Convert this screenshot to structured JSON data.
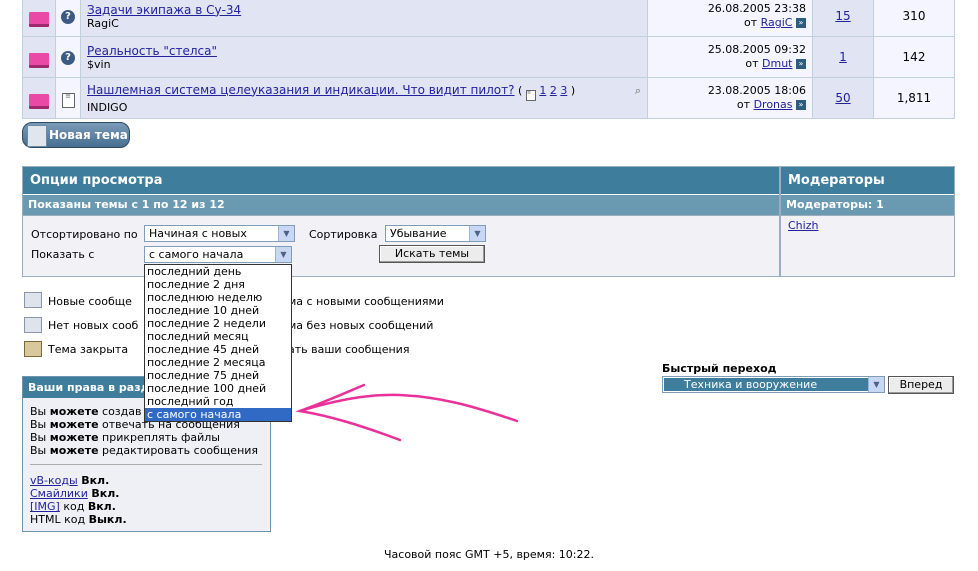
{
  "threads": [
    {
      "title": "Задачи экипажа в Су-34",
      "author": "RagiC",
      "last_date": "26.08.2005 23:38",
      "last_by": "от",
      "last_user": "RagiC",
      "replies": "15",
      "views": "310",
      "pages": null
    },
    {
      "title": "Реальность \"стелса\"",
      "author": "$vin",
      "last_date": "25.08.2005 09:32",
      "last_by": "от",
      "last_user": "Dmut",
      "replies": "1",
      "views": "142",
      "pages": null
    },
    {
      "title": "Нашлемная система целеуказания и индикации. Что видит пилот?",
      "author": "INDIGO",
      "last_date": "23.08.2005 18:06",
      "last_by": "от",
      "last_user": "Dronas",
      "replies": "50",
      "views": "1,811",
      "pages": {
        "open": "(",
        "items": [
          "1",
          "2",
          "3"
        ],
        "close": ")"
      }
    }
  ],
  "new_thread_label": "Новая тема",
  "view_options": {
    "title": "Опции просмотра",
    "subtitle": "Показаны темы с 1 по 12 из 12",
    "sorted_by_label": "Отсортировано по",
    "sorted_by_value": "Начиная с новых",
    "sort_label": "Сортировка",
    "sort_value": "Убывание",
    "show_label": "Показать с",
    "show_value": "с самого начала",
    "search_button": "Искать темы",
    "show_options": [
      "последний день",
      "последние 2 дня",
      "последнюю неделю",
      "последние 10 дней",
      "последние 2 недели",
      "последний месяц",
      "последние 45 дней",
      "последние 2 месяца",
      "последние 75 дней",
      "последние 100 дней",
      "последний год",
      "с самого начала"
    ],
    "selected_index": 11
  },
  "moderators": {
    "title": "Модераторы",
    "subtitle": "Модераторы: 1",
    "list": [
      "Chizh"
    ]
  },
  "legend": {
    "new_posts": "Новые сообще",
    "new_posts_right": "ма с новыми сообщениями",
    "no_new_posts": "Нет новых сооб",
    "no_new_posts_right": "ма без новых сообщений",
    "closed": "Тема закрыта",
    "closed_right": "ать ваши сообщения"
  },
  "permissions": {
    "title": "Ваши права в разде",
    "lines": [
      {
        "pre": "Вы",
        "bold": "можете",
        "post": "создав"
      },
      {
        "pre": "Вы",
        "bold": "можете",
        "post": "отвечать на сообщения"
      },
      {
        "pre": "Вы",
        "bold": "можете",
        "post": "прикреплять файлы"
      },
      {
        "pre": "Вы",
        "bold": "можете",
        "post": "редактировать сообщения"
      }
    ],
    "codes": [
      {
        "link": "vB-коды",
        "mid": "",
        "status": "Вкл."
      },
      {
        "link": "Смайлики",
        "mid": "",
        "status": "Вкл."
      },
      {
        "link": "[IMG]",
        "mid": "код",
        "status": "Вкл."
      },
      {
        "link": "",
        "mid": "HTML код",
        "status": "Выкл."
      }
    ]
  },
  "quick_jump": {
    "label": "Быстрый переход",
    "value": "Техника и вооружение",
    "button": "Вперед"
  },
  "footer": "Часовой пояс GMT +5, время: 10:22.",
  "colors": {
    "header": "#3e7e9c",
    "subheader": "#6a9ab2",
    "link": "#22229c",
    "arrow": "#e8329a"
  }
}
